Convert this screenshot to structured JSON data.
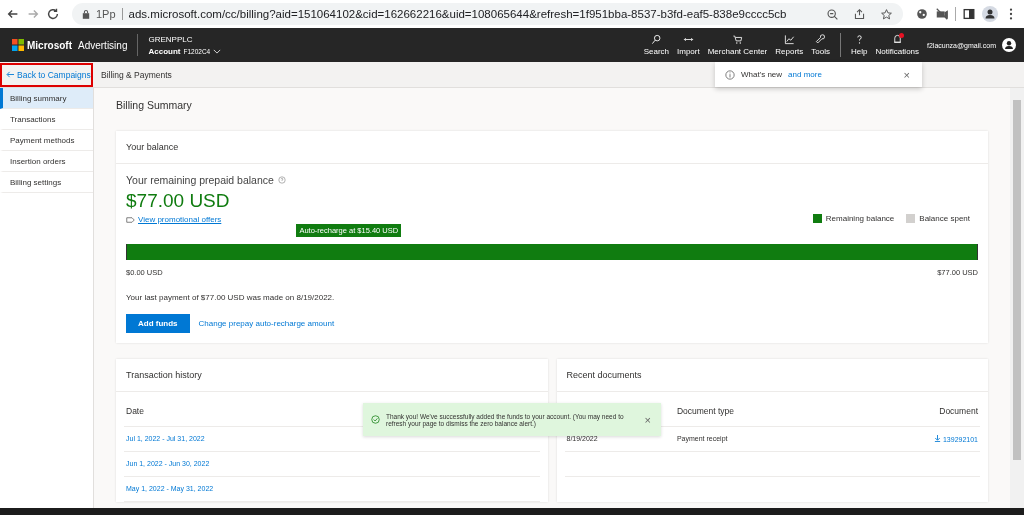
{
  "browser": {
    "site_label": "1Pp",
    "url": "ads.microsoft.com/cc/billing?aid=151064102&cid=162662216&uid=108065644&refresh=1f951bba-8537-b3fd-eaf5-838e9cccc5cb"
  },
  "header": {
    "brand": "Microsoft",
    "product": "Advertising",
    "account_name": "GRENPPLC",
    "account_label": "Account",
    "account_id": "F1202C4",
    "tools": [
      {
        "kind": "search",
        "label": "Search"
      },
      {
        "kind": "import",
        "label": "Import"
      },
      {
        "kind": "cart",
        "label": "Merchant Center"
      },
      {
        "kind": "chart",
        "label": "Reports"
      },
      {
        "kind": "wrench",
        "label": "Tools"
      },
      {
        "kind": "help",
        "label": "Help"
      },
      {
        "kind": "bell",
        "label": "Notifications",
        "badge": true
      }
    ],
    "email": "f2lacunza@gmail.com"
  },
  "breadcrumb": {
    "back": "Back to Campaigns",
    "back_highlighted": true,
    "current": "Billing & Payments"
  },
  "whats_new": {
    "text": "What's new",
    "link": "and more",
    "close": "×"
  },
  "sidebar": {
    "items": [
      {
        "label": "Billing summary",
        "selected": true
      },
      {
        "label": "Transactions",
        "selected": false
      },
      {
        "label": "Payment methods",
        "selected": false
      },
      {
        "label": "Insertion orders",
        "selected": false
      },
      {
        "label": "Billing settings",
        "selected": false
      }
    ]
  },
  "page_title": "Billing Summary",
  "balance": {
    "title": "Your balance",
    "subtitle": "Your remaining prepaid balance",
    "amount": "$77.00 USD",
    "promo_link": "View promotional offers",
    "legend": [
      {
        "label": "Remaining balance",
        "color": "#107c10"
      },
      {
        "label": "Balance spent",
        "color": "#d2d0ce"
      }
    ],
    "bar": {
      "level": 1.0,
      "min_label": "$0.00 USD",
      "max_label": "$77.00 USD"
    },
    "marker": {
      "label": "Auto-recharge at $15.40 USD",
      "level": 0.2
    },
    "last_payment": "Your last payment of $77.00 USD was made on 8/19/2022.",
    "add_button": "Add funds",
    "change_link": "Change prepay auto-recharge amount"
  },
  "transactions": {
    "title": "Transaction history",
    "column": "Date",
    "rows": [
      "Jul 1, 2022 - Jul 31, 2022",
      "Jun 1, 2022 - Jun 30, 2022",
      "May 1, 2022 - May 31, 2022"
    ]
  },
  "documents": {
    "title": "Recent documents",
    "columns": [
      "Document type",
      "Document"
    ],
    "rows": [
      {
        "date": "8/19/2022",
        "type": "Payment receipt",
        "number": "139292101"
      }
    ]
  },
  "toast": {
    "text": "Thank you! We've successfully added the funds to your account. (You may need to refresh your page to dismiss the zero balance alert.)",
    "close": "×"
  }
}
